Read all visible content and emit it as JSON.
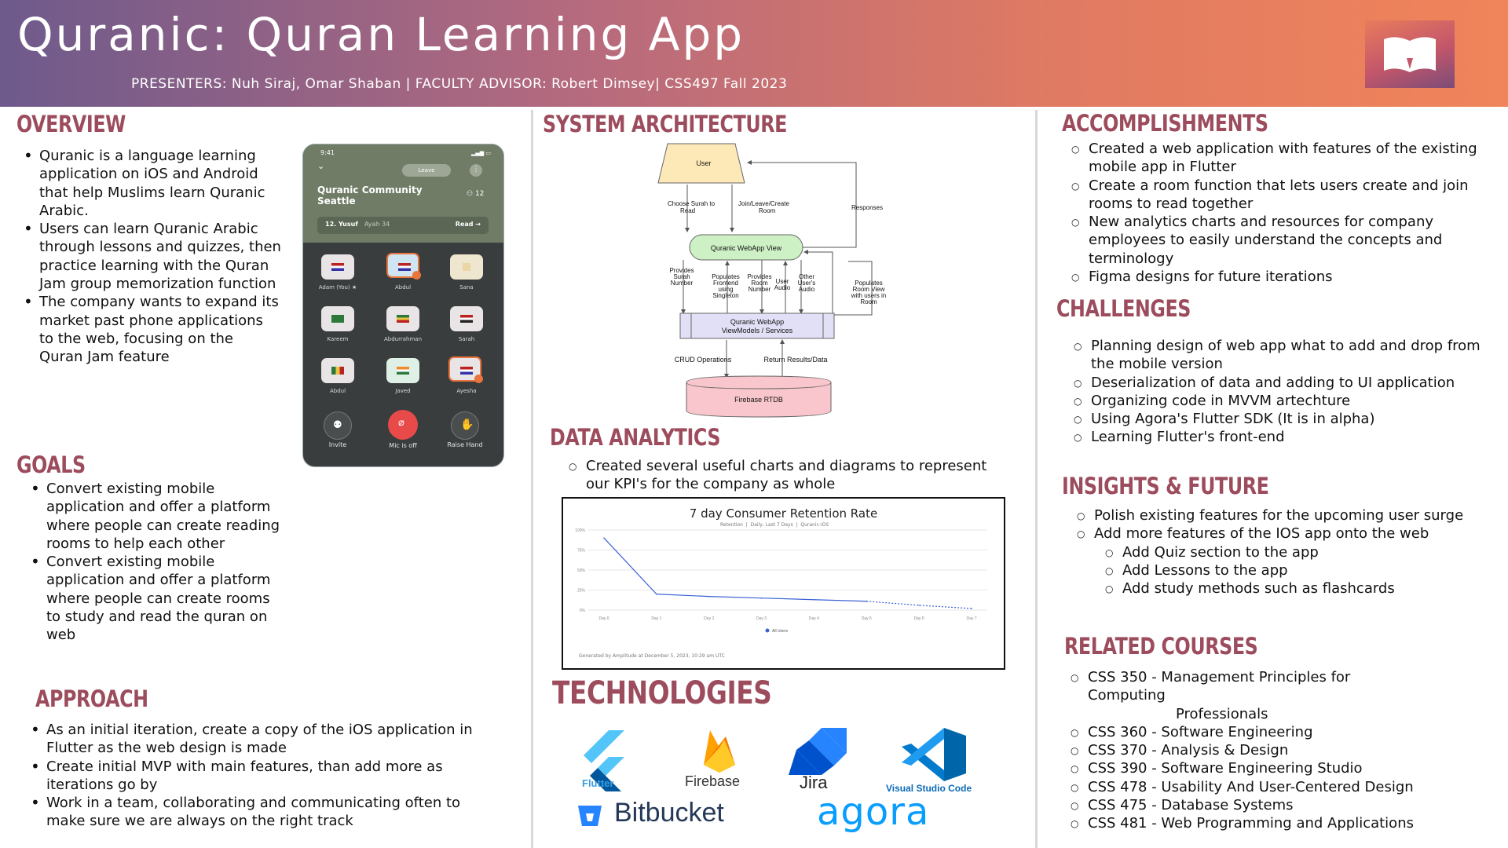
{
  "header": {
    "title": "Quranic: Quran Learning App",
    "subtitle": "PRESENTERS: Nuh Siraj, Omar Shaban | FACULTY ADVISOR: Robert Dimsey| CSS497 Fall 2023",
    "logo_icon": "open-book-icon"
  },
  "overview": {
    "title": "OVERVIEW",
    "items": [
      "Quranic is a language learning application on iOS and Android that help Muslims learn Quranic Arabic.",
      "Users can learn Quranic Arabic through lessons and quizzes, then practice learning with the Quran Jam group memorization function",
      "The company wants to expand its market past phone applications to the web, focusing on the Quran Jam feature"
    ]
  },
  "phone": {
    "time": "9:41",
    "leave": "Leave",
    "room_line1": "Quranic Community",
    "room_line2": "Seattle",
    "member_count": "12",
    "surah_name": "12. Yusuf",
    "ayah": "Ayah 34",
    "read": "Read",
    "participants": [
      "Adam (You)",
      "Abdul",
      "Sana",
      "Kareem",
      "Abdurrahman",
      "Sarah",
      "Abdul",
      "Javed",
      "Ayesha"
    ],
    "controls": [
      "Invite",
      "Mic is off",
      "Raise Hand"
    ]
  },
  "goals": {
    "title": "GOALS",
    "items": [
      "Convert existing mobile application and offer a platform where people can create reading rooms to help each other",
      "Convert existing mobile application and offer a platform where people can create rooms to study and read the quran on web"
    ]
  },
  "approach": {
    "title": "APPROACH",
    "items": [
      "As an initial iteration, create a copy of the iOS application in Flutter as the web design is made",
      "Create initial MVP with main features, than add more as iterations go by",
      "Work in a team, collaborating and communicating often to make sure we are always on the right track"
    ]
  },
  "architecture": {
    "title": "SYSTEM ARCHITECTURE",
    "user": "User",
    "view": "Quranic WebApp View",
    "viewmodels_line1": "Quranic WebApp",
    "viewmodels_line2": "ViewModels / Services",
    "db": "Firebase RTDB",
    "choose_surah_1": "Choose Surah to",
    "choose_surah_2": "Read",
    "join_room_1": "Join/Leave/Create",
    "join_room_2": "Room",
    "responses": "Responses",
    "provides_surah": [
      "Provides",
      "Surah",
      "Number"
    ],
    "populates_frontend": [
      "Populates",
      "Frontend",
      "using",
      "Singleton"
    ],
    "provides_room": [
      "Provides",
      "Room",
      "Number"
    ],
    "user_audio": [
      "User",
      "Audio"
    ],
    "other_audio": [
      "Other",
      "User's",
      "Audio"
    ],
    "populates_room": [
      "Populates",
      "Room View",
      "with users in",
      "Room"
    ],
    "crud": "CRUD Operations",
    "return_results": "Return Results/Data"
  },
  "analytics": {
    "title": "DATA ANALYTICS",
    "items": [
      "Created several useful charts and diagrams to represent our KPI's for the company as whole"
    ]
  },
  "chart_data": {
    "type": "line",
    "title": "7 day Consumer Retention Rate",
    "subtitle_parts": [
      "Retention",
      "Daily, Last 7 Days",
      "Quranic-iOS"
    ],
    "categories": [
      "Day 0",
      "Day 1",
      "Day 2",
      "Day 3",
      "Day 4",
      "Day 5",
      "Day 6",
      "Day 7"
    ],
    "series": [
      {
        "name": "All Users",
        "values": [
          90,
          20,
          17,
          15,
          13,
          11,
          6,
          2
        ],
        "dashed_from_index": 5,
        "color": "#3b62d6"
      }
    ],
    "yticks": [
      "100%",
      "75%",
      "50%",
      "25%",
      "0%"
    ],
    "ylim": [
      0,
      100
    ],
    "footer": "Generated by Amplitude at December 5, 2023, 10:29 am UTC",
    "legend_placement": "bottom"
  },
  "technologies": {
    "title": "TECHNOLOGIES",
    "flutter": "Flutter",
    "firebase": "Firebase",
    "jira": "Jira",
    "vscode": "Visual Studio Code",
    "bitbucket": "Bitbucket",
    "agora": "agora"
  },
  "accomplishments": {
    "title": "ACCOMPLISHMENTS",
    "items": [
      "Created a web application with features of the existing mobile app in Flutter",
      "Create a room function that lets users create and join rooms to read together",
      "New analytics charts and resources for company employees to easily understand the concepts and terminology",
      "Figma designs for future iterations"
    ]
  },
  "challenges": {
    "title": "CHALLENGES",
    "items": [
      "Planning design of web app what to add and drop from the mobile version",
      "Deserialization of data and adding to UI application",
      "Organizing code in MVVM artechture",
      "Using Agora's Flutter SDK (It is in alpha)",
      "Learning Flutter's front-end"
    ]
  },
  "insights": {
    "title": "INSIGHTS & FUTURE",
    "items": [
      "Polish existing features for the upcoming user surge",
      "Add more features of the IOS app onto the web"
    ],
    "subitems": [
      "Add Quiz section to the app",
      "Add Lessons to the app",
      "Add study methods such as flashcards"
    ]
  },
  "courses": {
    "title": "RELATED COURSES",
    "item1_main": "CSS 350 - Management Principles for Computing",
    "item1_cont": "Professionals",
    "items": [
      "CSS 360 - Software Engineering",
      "CSS 370 - Analysis & Design",
      "CSS 390 - Software Engineering Studio",
      "CSS 478 - Usability And User-Centered Design",
      "CSS 475 - Database Systems",
      "CSS 481 - Web Programming and Applications"
    ]
  },
  "colors": {
    "accent": "#9c4c5c",
    "header_start": "#6e5a8c",
    "header_end": "#f0845a"
  }
}
